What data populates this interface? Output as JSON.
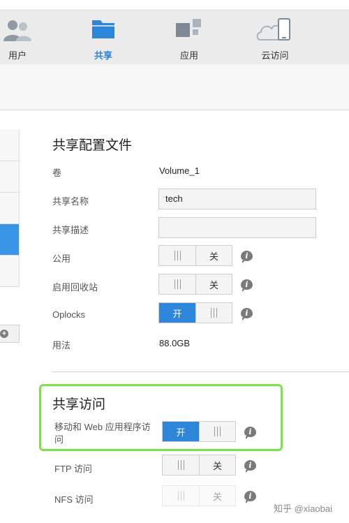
{
  "nav": {
    "items": [
      {
        "label": "用户",
        "icon": "users-icon",
        "active": false
      },
      {
        "label": "共享",
        "icon": "folder-icon",
        "active": true
      },
      {
        "label": "应用",
        "icon": "apps-icon",
        "active": false
      },
      {
        "label": "云访问",
        "icon": "cloud-access-icon",
        "active": false
      }
    ]
  },
  "profile": {
    "title": "共享配置文件",
    "volume_label": "卷",
    "volume_value": "Volume_1",
    "share_name_label": "共享名称",
    "share_name_value": "tech",
    "share_desc_label": "共享描述",
    "share_desc_value": "",
    "public_label": "公用",
    "public_state": "关",
    "recycle_label": "启用回收站",
    "recycle_state": "关",
    "oplocks_label": "Oplocks",
    "oplocks_state": "开",
    "usage_label": "用法",
    "usage_value": "88.0GB"
  },
  "access": {
    "title": "共享访问",
    "mobile_web_label": "移动和 Web 应用程序访问",
    "mobile_web_state": "开",
    "ftp_label": "FTP 访问",
    "ftp_state": "关",
    "nfs_label": "NFS 访问",
    "nfs_state": "关"
  },
  "toggle_on_text": "开",
  "toggle_off_text": "关",
  "info_glyph": "i",
  "add_glyph": "+",
  "watermark": "知乎 @xiaobai",
  "colors": {
    "accent": "#2e86d8",
    "highlight": "#7ee04b",
    "selected_row": "#3a95e6"
  }
}
